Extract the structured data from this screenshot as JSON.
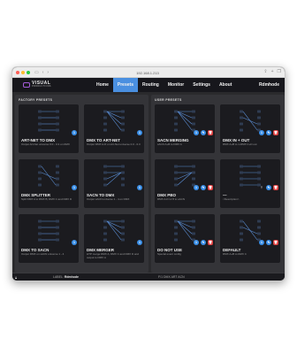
{
  "browser": {
    "url": "192.168.1.213",
    "traffic_colors": [
      "#ff5f57",
      "#febc2e",
      "#28c840"
    ]
  },
  "app": {
    "logo_title": "VISUAL",
    "logo_sub": "PRODUCTIONS",
    "nav": [
      "Home",
      "Presets",
      "Routing",
      "Monitor",
      "Settings",
      "About"
    ],
    "active_nav": "Presets",
    "node_name": "Rdmhode"
  },
  "factory": {
    "title": "FACTORY PRESETS",
    "cards": [
      {
        "title": "ART-NET TO DMX",
        "desc": "Output Art-Net universe 0.0 - 0.3 on DMX"
      },
      {
        "title": "DMX TO ART-NET",
        "desc": "Output DMX A-D on Art-Net universe 0.0 - 0.3"
      },
      {
        "title": "DMX SPLITTER",
        "desc": "Split DMX A to DMX B, DMX C and DMX D"
      },
      {
        "title": "SACN TO DMX",
        "desc": "Output sACN universe 1 - 4 on DMX"
      },
      {
        "title": "DMX TO SACN",
        "desc": "Output DMX on sACN universe 1 - 4"
      },
      {
        "title": "DMX MERGER",
        "desc": "HTP merge DMX A, DMX C and DMX D and output to DMX A"
      }
    ]
  },
  "user": {
    "title": "USER PRESETS",
    "cards": [
      {
        "title": "SACN MERGING",
        "desc": "sACN A+B to DMX A"
      },
      {
        "title": "DMX IN + OUT",
        "desc": "DMX A+B to 1-DMX C+D out"
      },
      {
        "title": "DMX PBO",
        "desc": "DMX A-D in/ 8 to sACN"
      },
      {
        "title": "—",
        "desc": "<Description>"
      },
      {
        "title": "DO NOT USE",
        "desc": "Special event config"
      },
      {
        "title": "DEFAULT",
        "desc": "DMX A+B to DMX C"
      }
    ]
  },
  "badges": {
    "one": "1",
    "two": "2",
    "edit": "✎",
    "delete": "🗑",
    "upload": "⇡"
  },
  "status": {
    "label_prefix": "LABEL:",
    "label_value": "Rdmhode",
    "center": "F/1 DMX ART ACN"
  }
}
